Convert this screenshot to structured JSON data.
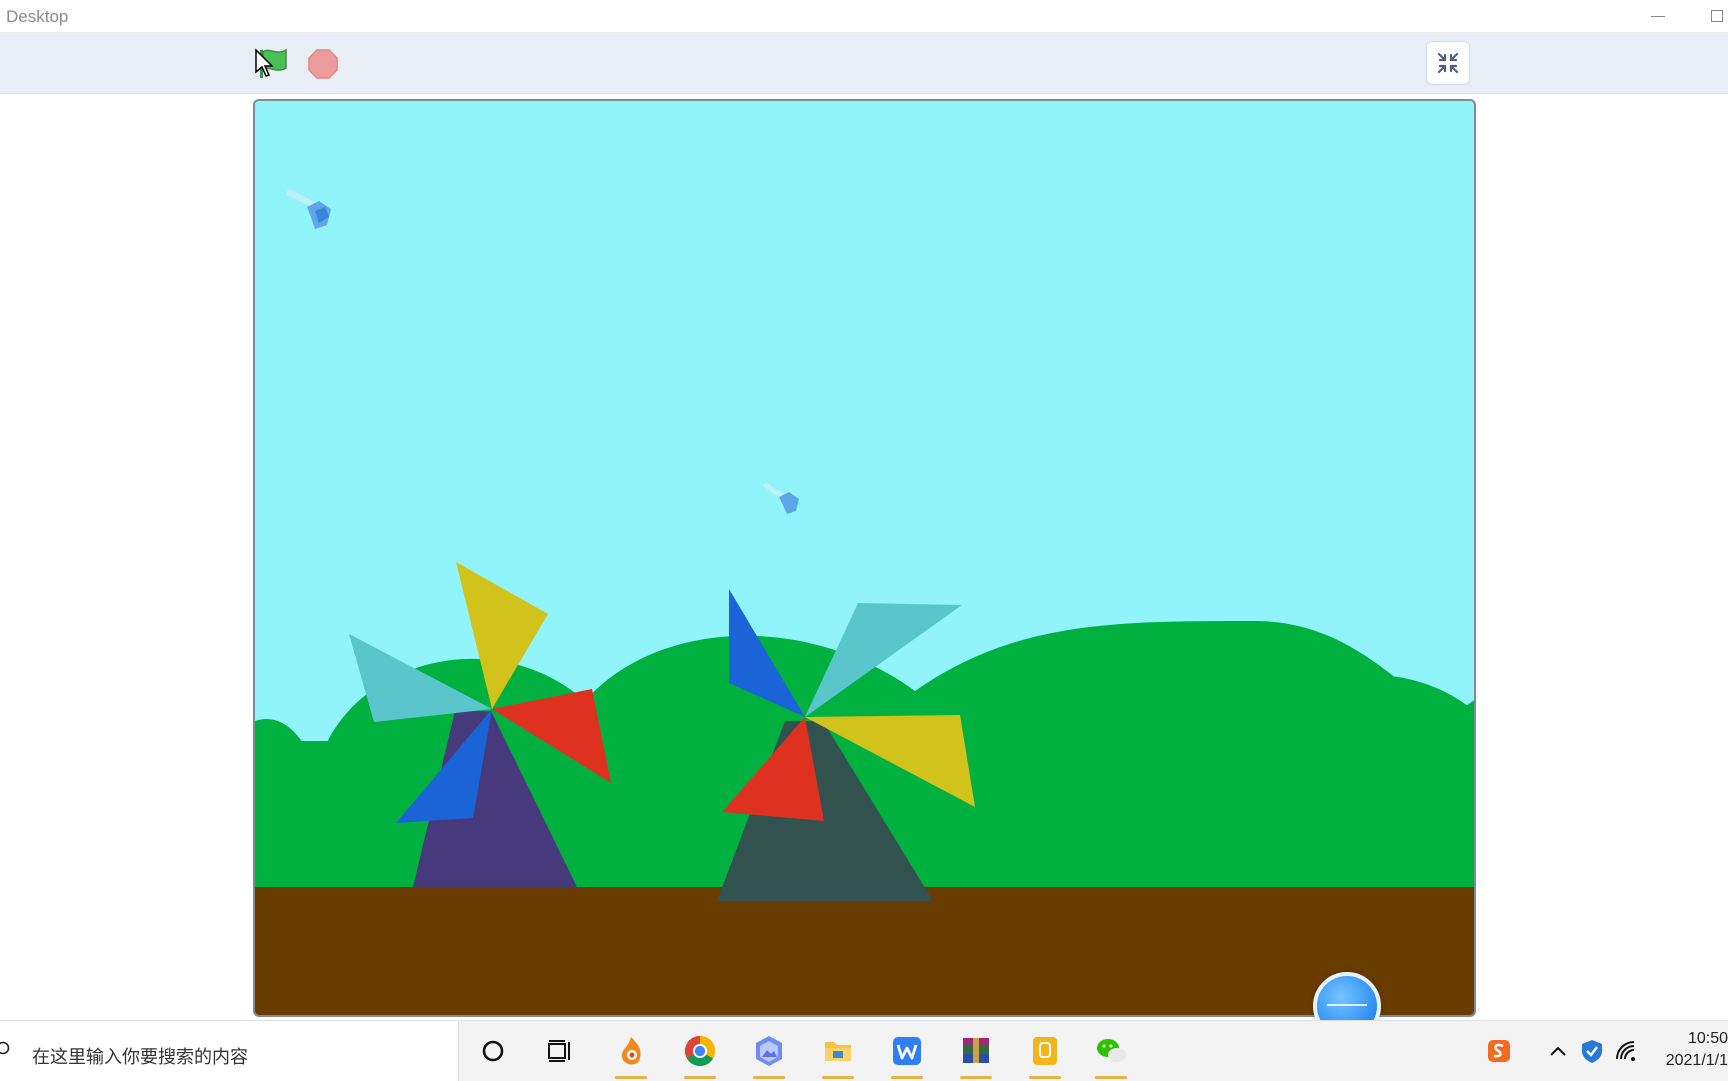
{
  "window": {
    "title": "Desktop"
  },
  "player": {
    "green_flag_icon": "green-flag",
    "stop_icon": "stop-sign",
    "fullscreen_icon": "exit-fullscreen",
    "colors": {
      "flag": "#4cbf56",
      "stop": "#ec9c9c",
      "toolbar_bg": "#e9eef6"
    }
  },
  "stage": {
    "colors": {
      "sky": "#91f4fb",
      "hills": "#00b140",
      "ground": "#693d00",
      "windmill1_tower": "#463a7c",
      "windmill2_tower": "#31524f",
      "blade_yellow": "#d2c21c",
      "blade_red": "#df3120",
      "blade_blue": "#1b64d8",
      "blade_cyan": "#5bc5cc"
    },
    "sprites": [
      "windmill",
      "windmill",
      "bird",
      "bird"
    ]
  },
  "taskbar": {
    "search_placeholder": "在这里输入你要搜索的内容",
    "apps": [
      "cortana-icon",
      "task-view-icon",
      "app-fire-icon",
      "chrome-icon",
      "photos-icon",
      "file-explorer-icon",
      "wps-icon",
      "winrar-icon",
      "notes-icon",
      "wechat-icon"
    ],
    "tray": [
      "sogou-input-icon",
      "chevron-up-icon",
      "security-shield-icon",
      "wifi-icon"
    ],
    "clock": {
      "time": "10:50",
      "date": "2021/1/1"
    }
  }
}
